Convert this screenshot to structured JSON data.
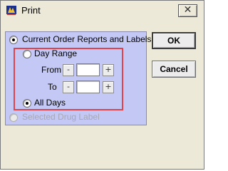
{
  "window": {
    "title": "Print",
    "close_glyph": "✕",
    "icon_name": "app-icon"
  },
  "options": {
    "current_order": {
      "label": "Current Order Reports and Labels",
      "checked": true
    },
    "day_range": {
      "label": "Day Range",
      "checked": false
    },
    "from": {
      "label": "From",
      "value": ""
    },
    "to": {
      "label": "To",
      "value": ""
    },
    "stepper_minus": "-",
    "stepper_plus": "+",
    "all_days": {
      "label": "All Days",
      "checked": true
    },
    "selected_drug": {
      "label": "Selected Drug Label",
      "disabled": true
    }
  },
  "buttons": {
    "ok": "OK",
    "cancel": "Cancel"
  },
  "colors": {
    "panel": "#c4c8f4",
    "highlight_box": "#e0434b"
  }
}
